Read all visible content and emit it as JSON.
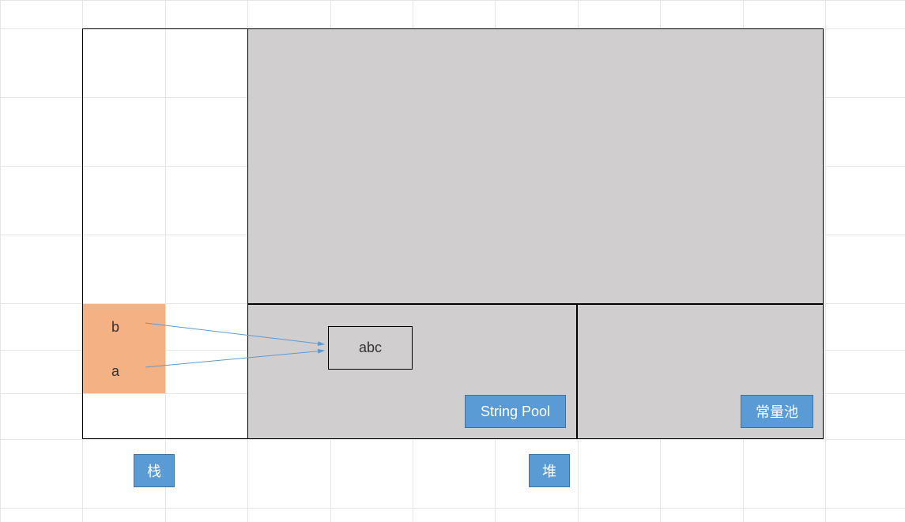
{
  "stack": {
    "items": [
      {
        "label": "b"
      },
      {
        "label": "a"
      }
    ],
    "button_label": "栈"
  },
  "heap": {
    "button_label": "堆",
    "string_pool": {
      "label": "String Pool",
      "value": "abc"
    },
    "constant_pool": {
      "label": "常量池"
    }
  }
}
